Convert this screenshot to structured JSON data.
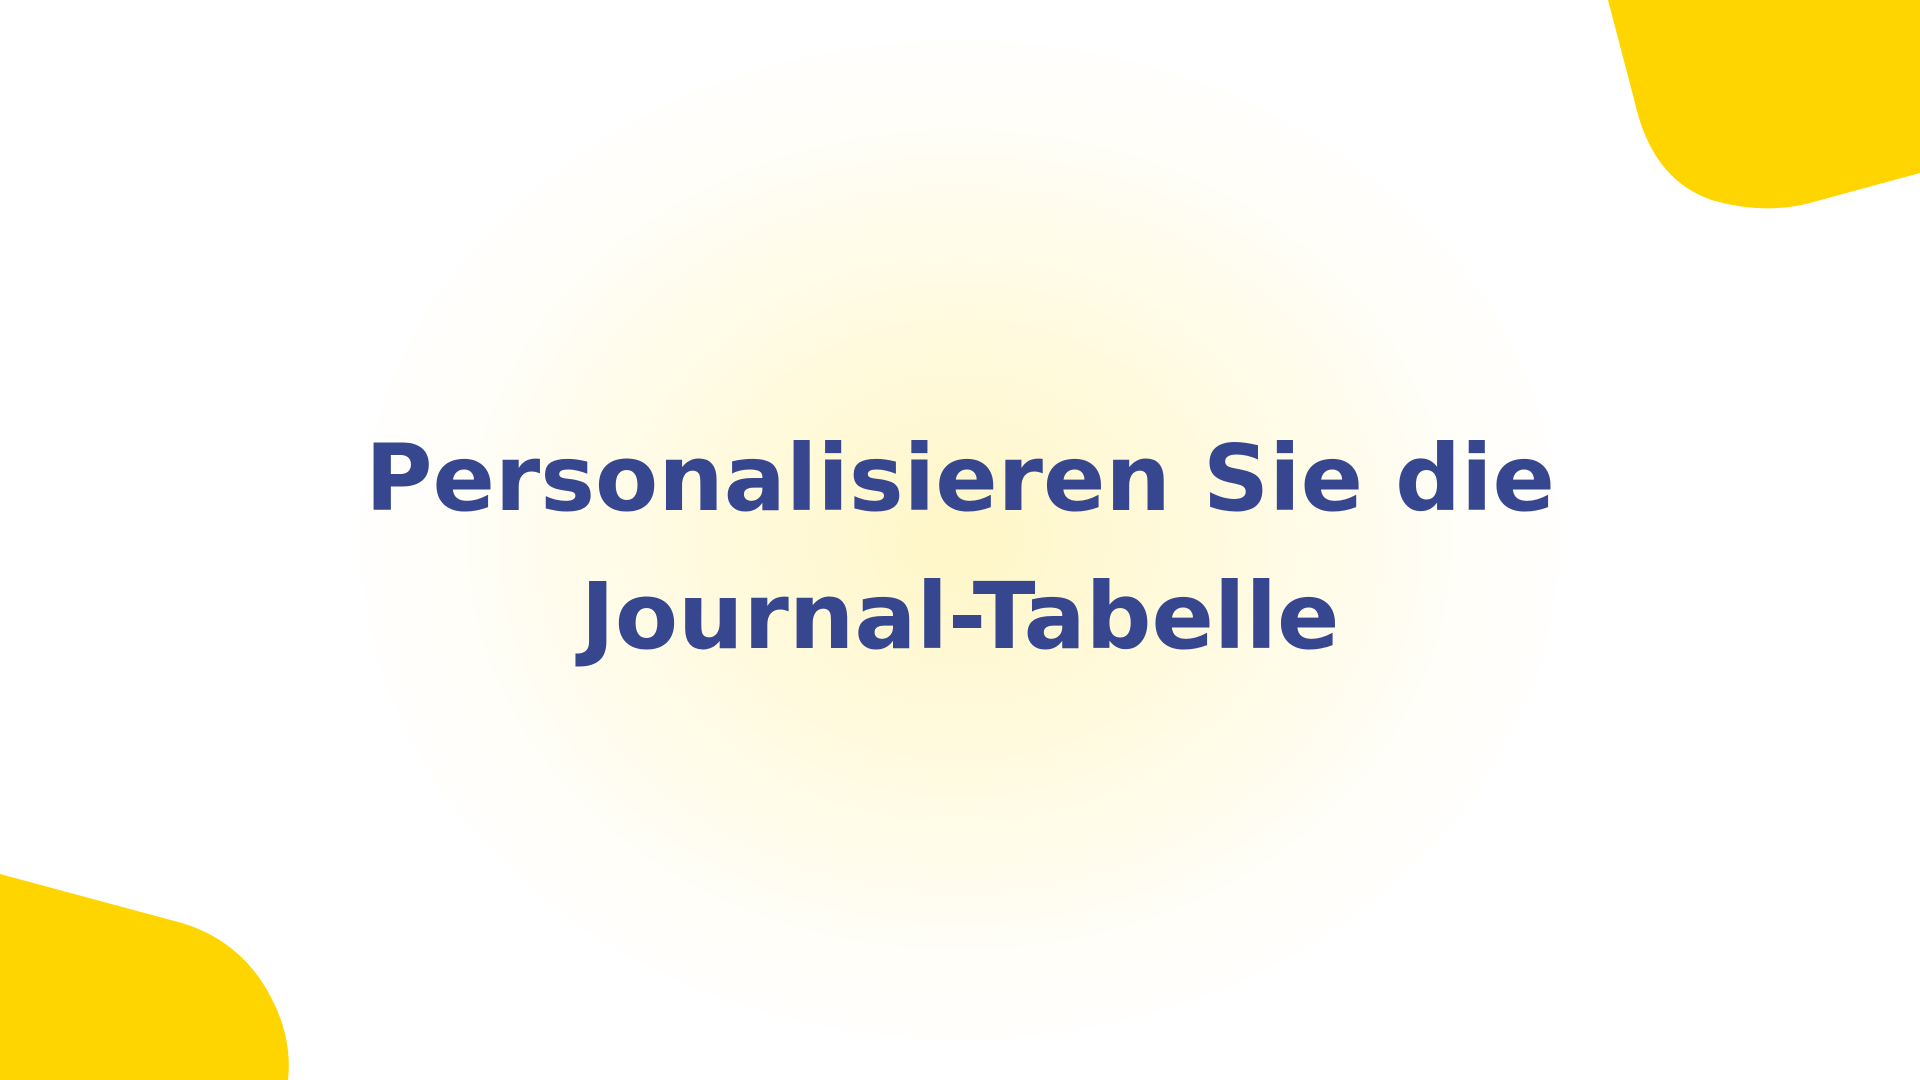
{
  "slide": {
    "title": "Personalisieren Sie die Journal-Tabelle"
  },
  "colors": {
    "background": "#ffffff",
    "accent_yellow": "#ffd500",
    "title_blue": "#36468f",
    "glow": "#fff6c4"
  },
  "decorations": {
    "top_right_shape": "yellow-rounded-corner-shape",
    "bottom_left_shape": "yellow-rounded-corner-shape"
  }
}
